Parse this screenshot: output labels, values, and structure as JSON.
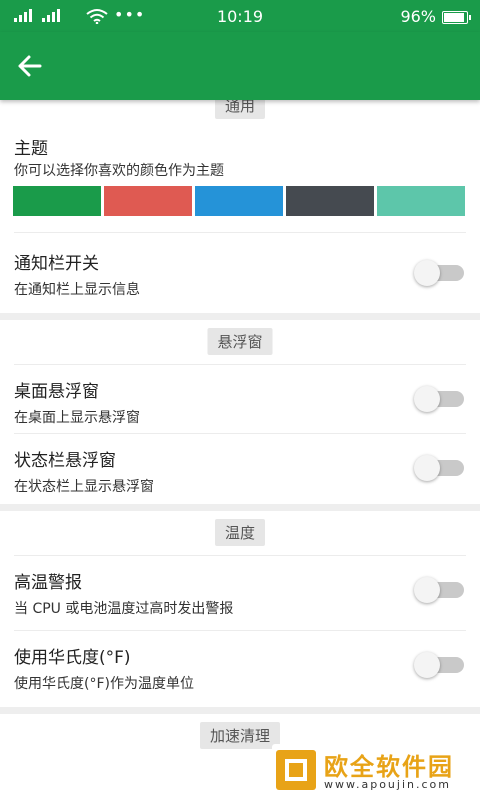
{
  "status_bar": {
    "time": "10:19",
    "battery": "96%"
  },
  "app_bar": {
    "back_icon": "arrow-left-icon"
  },
  "sections": {
    "general": "通用",
    "floating": "悬浮窗",
    "temperature": "温度",
    "boost": "加速清理"
  },
  "theme": {
    "title": "主题",
    "subtitle": "你可以选择你喜欢的颜色作为主题",
    "colors": [
      "#1a9b4a",
      "#df5a52",
      "#2593d8",
      "#454a50",
      "#5dc6aa"
    ]
  },
  "settings": {
    "notification": {
      "title": "通知栏开关",
      "subtitle": "在通知栏上显示信息",
      "on": false
    },
    "desktop_float": {
      "title": "桌面悬浮窗",
      "subtitle": "在桌面上显示悬浮窗",
      "on": false
    },
    "statusbar_float": {
      "title": "状态栏悬浮窗",
      "subtitle": "在状态栏上显示悬浮窗",
      "on": false
    },
    "high_temp": {
      "title": "高温警报",
      "subtitle": "当 CPU 或电池温度过高时发出警报",
      "on": false
    },
    "fahrenheit": {
      "title": "使用华氏度(°F)",
      "subtitle": "使用华氏度(°F)作为温度单位",
      "on": false
    }
  },
  "watermark": {
    "name": "欧全软件园",
    "url": "www.apoujin.com"
  }
}
